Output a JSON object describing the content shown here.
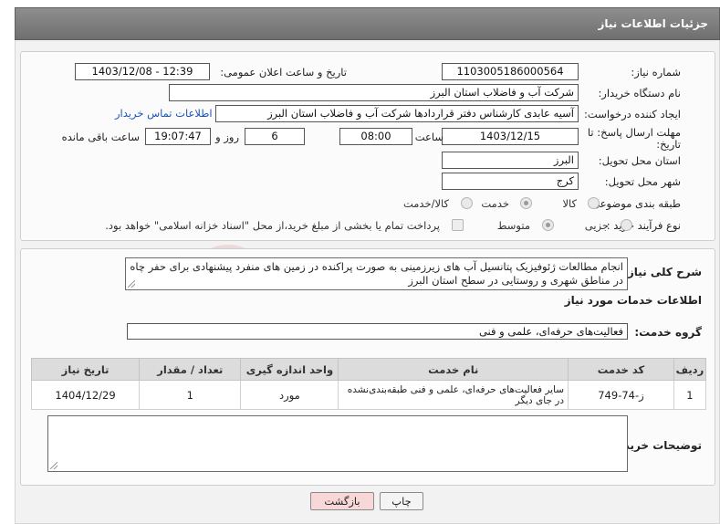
{
  "header": {
    "title": "جزئیات اطلاعات نیاز"
  },
  "form": {
    "need_number_label": "شماره نیاز:",
    "need_number": "1103005186000564",
    "announce_label": "تاریخ و ساعت اعلان عمومی:",
    "announce_value": "1403/12/08 - 12:39",
    "buyer_org_label": "نام دستگاه خریدار:",
    "buyer_org": "شرکت آب و فاضلاب استان البرز",
    "requester_label": "ایجاد کننده درخواست:",
    "requester": "آسیه عابدی کارشناس دفتر قراردادها شرکت آب و فاضلاب استان البرز",
    "contact_link": "اطلاعات تماس خریدار",
    "deadline_label_1": "مهلت ارسال پاسخ: تا",
    "deadline_label_2": "تاریخ:",
    "deadline_date": "1403/12/15",
    "time_label": "ساعت",
    "deadline_time": "08:00",
    "days_value": "6",
    "days_label": "روز و",
    "remaining_time": "19:07:47",
    "remaining_label": "ساعت باقی مانده",
    "province_label": "استان محل تحویل:",
    "province": "البرز",
    "city_label": "شهر محل تحویل:",
    "city": "کرج",
    "category_label": "طبقه بندی موضوعی:",
    "category_options": [
      "کالا",
      "خدمت",
      "کالا/خدمت"
    ],
    "category_selected": "خدمت",
    "process_label": "نوع فرآیند خرید :",
    "process_options": [
      "جزیی",
      "متوسط"
    ],
    "process_selected": "متوسط",
    "payment_note": "پرداخت تمام یا بخشی از مبلغ خرید،از محل \"اسناد خزانه اسلامی\" خواهد بود."
  },
  "description": {
    "label": "شرح کلی نیاز:",
    "text": "انجام مطالعات ژئوفیزیک پتانسیل آب های زیرزمینی به صورت پراکنده در زمین های منفرد پیشنهادی برای حفر چاه در مناطق شهری و روستایی در سطح استان البرز"
  },
  "services": {
    "section_title": "اطلاعات خدمات مورد نیاز",
    "group_label": "گروه خدمت:",
    "group_value": "فعالیت‌های حرفه‌ای، علمی و فنی",
    "columns": [
      "ردیف",
      "کد خدمت",
      "نام خدمت",
      "واحد اندازه گیری",
      "تعداد / مقدار",
      "تاریخ نیاز"
    ],
    "rows": [
      {
        "index": "1",
        "code": "ز-74-749",
        "name": "سایر فعالیت‌های حرفه‌ای، علمی و فنی طبقه‌بندی‌نشده در جای دیگر",
        "unit": "مورد",
        "quantity": "1",
        "date": "1404/12/29"
      }
    ]
  },
  "buyer_notes": {
    "label": "توضیحات خریدار:",
    "text": ""
  },
  "buttons": {
    "print": "چاپ",
    "back": "بازگشت"
  },
  "colors": {
    "header": "#7f7f7f",
    "link": "#1a55b8",
    "back_button": "#f7d7d7"
  },
  "watermark": {
    "text": "AriaTender.net"
  }
}
